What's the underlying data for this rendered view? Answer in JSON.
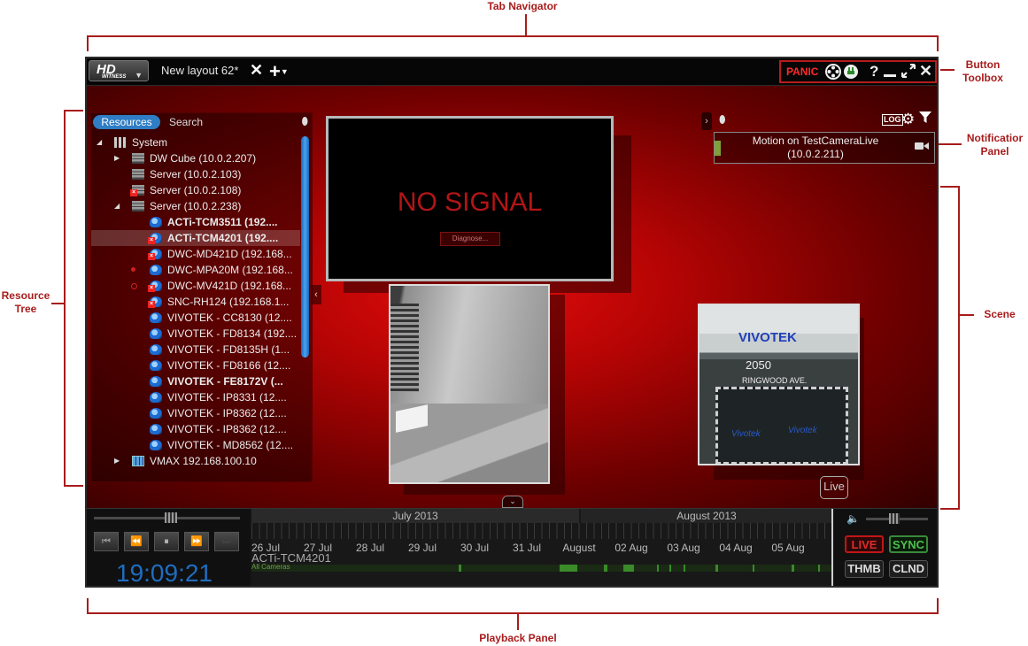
{
  "annotations": {
    "tab_navigator": "Tab Navigator",
    "button_toolbox": "Button\nToolbox",
    "notification_panel": "Notificatior\nPanel",
    "scene": "Scene",
    "resource_tree": "Resource\nTree",
    "playback_panel": "Playback Panel"
  },
  "app": {
    "logo_text": "HD",
    "logo_subtext": "WITNESS",
    "tab_label": "New layout 62*",
    "tab_close": "✕",
    "tab_add": "+",
    "toolbox": {
      "panic_label": "PANIC",
      "icons": [
        "film-reel-icon",
        "plug-icon",
        "help-icon",
        "minimize-icon",
        "fullscreen-icon",
        "close-icon"
      ],
      "help_glyph": "?",
      "close_glyph": "✕"
    }
  },
  "resource_tree": {
    "tabs": [
      "Resources",
      "Search"
    ],
    "active_tab": "Resources",
    "items": [
      {
        "label": "System",
        "icon": "grid-icon",
        "level": 0,
        "arrow": "◢"
      },
      {
        "label": "DW Cube (10.0.2.207)",
        "icon": "server-icon",
        "level": 1,
        "arrow": "▶"
      },
      {
        "label": "Server (10.0.2.103)",
        "icon": "server-icon",
        "level": 1
      },
      {
        "label": "Server (10.0.2.108)",
        "icon": "server-offline-icon",
        "level": 1,
        "error": true
      },
      {
        "label": "Server (10.0.2.238)",
        "icon": "server-icon",
        "level": 1,
        "arrow": "◢"
      },
      {
        "label": "ACTi-TCM3511 (192....",
        "icon": "camera-icon",
        "level": 2,
        "bold": true
      },
      {
        "label": "ACTi-TCM4201 (192....",
        "icon": "camera-icon",
        "level": 2,
        "bold": true,
        "selected": true,
        "error": true
      },
      {
        "label": "DWC-MD421D (192.168...",
        "icon": "camera-icon",
        "level": 2,
        "error": true
      },
      {
        "label": "DWC-MPA20M (192.168...",
        "icon": "camera-icon",
        "level": 2,
        "recording": "solid"
      },
      {
        "label": "DWC-MV421D (192.168...",
        "icon": "camera-icon",
        "level": 2,
        "recording": "ring",
        "error": true
      },
      {
        "label": "SNC-RH124 (192.168.1...",
        "icon": "camera-icon",
        "level": 2,
        "error": true
      },
      {
        "label": "VIVOTEK - CC8130 (12....",
        "icon": "camera-icon",
        "level": 2
      },
      {
        "label": "VIVOTEK - FD8134 (192....",
        "icon": "camera-icon",
        "level": 2
      },
      {
        "label": "VIVOTEK - FD8135H (1...",
        "icon": "camera-icon",
        "level": 2
      },
      {
        "label": "VIVOTEK - FD8166 (12....",
        "icon": "camera-icon",
        "level": 2
      },
      {
        "label": "VIVOTEK - FE8172V (...",
        "icon": "camera-icon",
        "level": 2,
        "bold": true
      },
      {
        "label": "VIVOTEK - IP8331 (12....",
        "icon": "camera-icon",
        "level": 2
      },
      {
        "label": "VIVOTEK - IP8362 (12....",
        "icon": "camera-icon",
        "level": 2
      },
      {
        "label": "VIVOTEK - IP8362 (12....",
        "icon": "camera-icon",
        "level": 2
      },
      {
        "label": "VIVOTEK - MD8562 (12....",
        "icon": "camera-icon",
        "level": 2
      },
      {
        "label": "VMAX 192.168.100.10",
        "icon": "vmax-icon",
        "level": 1,
        "arrow": "▶"
      }
    ]
  },
  "scene": {
    "no_signal_text": "NO SIGNAL",
    "diagnose_button": "Diagnose...",
    "camera2_overlay": {
      "logo": "VIVOTEK",
      "number": "2050",
      "street": "RINGWOOD AVE.",
      "sign_left": "Vivotek",
      "sign_right": "Vivotek"
    },
    "live_tag": "Live"
  },
  "notifications": {
    "log_button": "LOG",
    "items": [
      {
        "line1": "Motion on TestCameraLive",
        "line2": "(10.0.2.211)",
        "color": "#7fa03a"
      }
    ]
  },
  "playback": {
    "clock": "19:09:21",
    "months": [
      "July 2013",
      "August 2013"
    ],
    "days": [
      "26 Jul",
      "27 Jul",
      "28 Jul",
      "29 Jul",
      "30 Jul",
      "31 Jul",
      "August",
      "02 Aug",
      "03 Aug",
      "04 Aug",
      "05 Aug"
    ],
    "camera_label": "ACTi-TCM4201",
    "all_cameras_label": "All Cameras",
    "buttons": [
      "LIVE",
      "SYNC",
      "THMB",
      "CLND"
    ],
    "transport": [
      "⏮",
      "⏪",
      "⏸",
      "⏩",
      "⏭"
    ]
  },
  "colors": {
    "accent_red": "#b71c1c",
    "live_red": "#e02a2a",
    "sync_green": "#4ec04e",
    "clock_blue": "#1f6dbf",
    "selection_blue": "#2f7dc4"
  }
}
